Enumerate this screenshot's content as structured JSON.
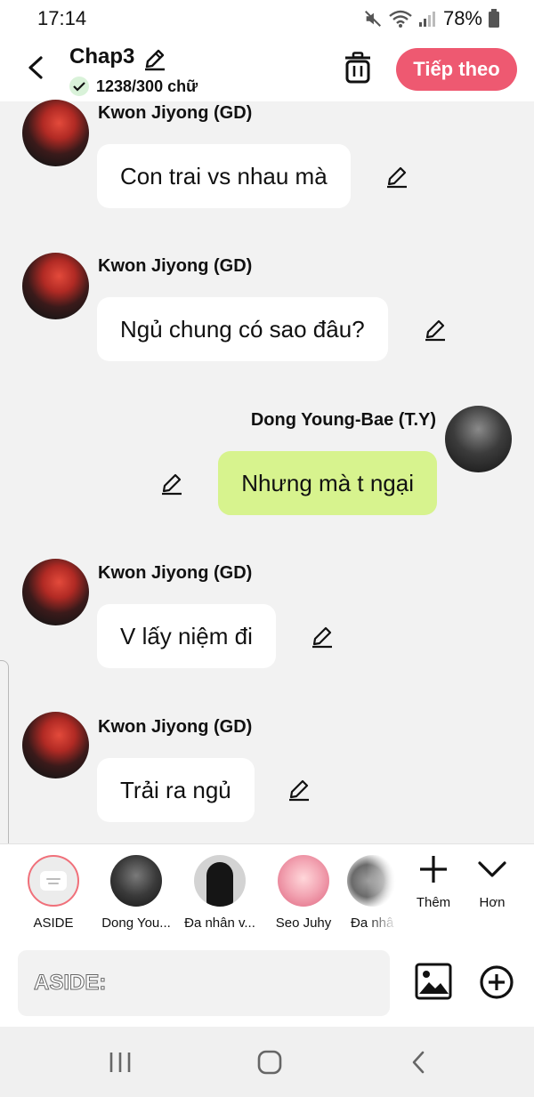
{
  "status_bar": {
    "time": "17:14",
    "battery": "78%"
  },
  "header": {
    "title": "Chap3",
    "word_count": "1238/300 chữ",
    "next_label": "Tiếp theo"
  },
  "messages": [
    {
      "sender": "Kwon Jiyong (GD)",
      "text": "Con trai vs nhau mà",
      "side": "left"
    },
    {
      "sender": "Kwon Jiyong (GD)",
      "text": "Ngủ chung có sao đâu?",
      "side": "left"
    },
    {
      "sender": "Dong Young-Bae (T.Y)",
      "text": "Nhưng mà t ngại",
      "side": "right"
    },
    {
      "sender": "Kwon Jiyong (GD)",
      "text": "V lấy niệm đi",
      "side": "left"
    },
    {
      "sender": "Kwon Jiyong (GD)",
      "text": "Trải ra ngủ",
      "side": "left"
    }
  ],
  "characters": [
    {
      "label": "ASIDE"
    },
    {
      "label": "Dong You..."
    },
    {
      "label": "Đa nhân v..."
    },
    {
      "label": "Seo Juhy"
    },
    {
      "label": "Đa nhâ"
    }
  ],
  "bar_actions": {
    "more_label": "Thêm",
    "collapse_label": "Hơn"
  },
  "input": {
    "placeholder": "ASIDE:"
  },
  "colors": {
    "accent": "#ee5971",
    "mine_bubble": "#d7f38e",
    "other_bubble": "#ffffff",
    "background": "#f2f2f2"
  },
  "icons": [
    "mute-icon",
    "wifi-icon",
    "signal-icon",
    "battery-icon",
    "back-arrow-icon",
    "pencil-icon",
    "check-icon",
    "trash-icon",
    "plus-icon",
    "chevron-down-icon",
    "image-icon",
    "plus-circle-icon",
    "recent-apps-icon",
    "home-icon",
    "nav-back-icon"
  ]
}
